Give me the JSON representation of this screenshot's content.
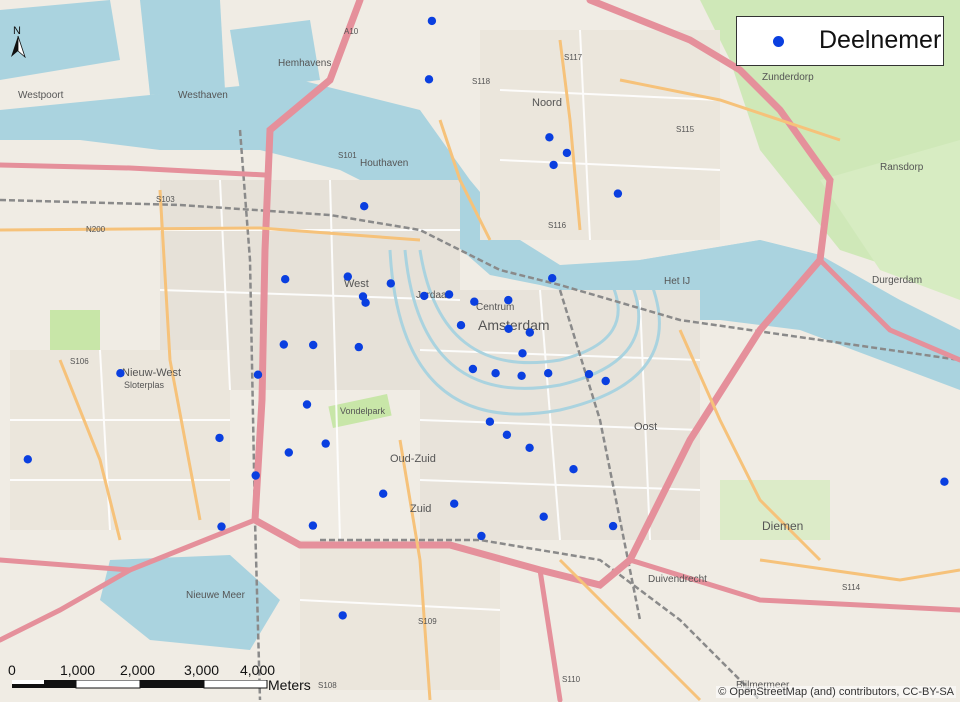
{
  "legend": {
    "label": "Deelnemer",
    "marker_color": "#0a3fe0"
  },
  "north_arrow": {
    "label": "N"
  },
  "scale_bar": {
    "ticks": [
      "0",
      "1,000",
      "2,000",
      "3,000",
      "4,000"
    ],
    "unit": "Meters"
  },
  "attribution": "© OpenStreetMap (and) contributors, CC-BY-SA",
  "place_labels": {
    "amsterdam": "Amsterdam",
    "centrum": "Centrum",
    "noord": "Noord",
    "west": "West",
    "nieuw_west": "Nieuw-West",
    "oost": "Oost",
    "zuid": "Zuid",
    "oud_zuid": "Oud-Zuid",
    "diemen": "Diemen",
    "durgerdam": "Durgerdam",
    "zunderdorp": "Zunderdorp",
    "ransdorp": "Ransdorp",
    "westpoort": "Westpoort",
    "hemhavens": "Hemhavens",
    "westhaven": "Westhaven",
    "houthaven": "Houthaven",
    "jordaan": "Jordaan",
    "ij": "Het IJ",
    "nieuwe_meer": "Nieuwe Meer",
    "duivendrecht": "Duivendrecht",
    "sloterplas": "Sloterplas",
    "vondelpark": "Vondelpark",
    "bijlmermeer": "Bijlmermeer"
  },
  "road_labels": {
    "a10": "A10",
    "s101": "S101",
    "s118": "S118",
    "s116": "S116",
    "s115": "S115",
    "s117": "S117",
    "s103": "S103",
    "s106": "S106",
    "s108": "S108",
    "s109": "S109",
    "s110": "S110",
    "s114": "S114",
    "n200": "N200"
  },
  "participants": [
    {
      "lon": 4.9035,
      "lat": 52.4045
    },
    {
      "lon": 4.9025,
      "lat": 52.3933
    },
    {
      "lon": 4.945,
      "lat": 52.3822
    },
    {
      "lon": 4.9465,
      "lat": 52.3769
    },
    {
      "lon": 4.9512,
      "lat": 52.3792
    },
    {
      "lon": 4.9692,
      "lat": 52.3714
    },
    {
      "lon": 4.8796,
      "lat": 52.369
    },
    {
      "lon": 4.8517,
      "lat": 52.355
    },
    {
      "lon": 4.8738,
      "lat": 52.3555
    },
    {
      "lon": 4.889,
      "lat": 52.3542
    },
    {
      "lon": 4.946,
      "lat": 52.3552
    },
    {
      "lon": 4.8792,
      "lat": 52.3517
    },
    {
      "lon": 4.8801,
      "lat": 52.3505
    },
    {
      "lon": 4.9008,
      "lat": 52.3518
    },
    {
      "lon": 4.9096,
      "lat": 52.3521
    },
    {
      "lon": 4.9185,
      "lat": 52.3507
    },
    {
      "lon": 4.9305,
      "lat": 52.351
    },
    {
      "lon": 4.9138,
      "lat": 52.3462
    },
    {
      "lon": 4.9306,
      "lat": 52.3455
    },
    {
      "lon": 4.9381,
      "lat": 52.3448
    },
    {
      "lon": 4.8512,
      "lat": 52.3425
    },
    {
      "lon": 4.8616,
      "lat": 52.3424
    },
    {
      "lon": 4.8777,
      "lat": 52.342
    },
    {
      "lon": 4.9355,
      "lat": 52.3408
    },
    {
      "lon": 4.7935,
      "lat": 52.337
    },
    {
      "lon": 4.8421,
      "lat": 52.3367
    },
    {
      "lon": 4.918,
      "lat": 52.3378
    },
    {
      "lon": 4.926,
      "lat": 52.337
    },
    {
      "lon": 4.9352,
      "lat": 52.3365
    },
    {
      "lon": 4.9446,
      "lat": 52.337
    },
    {
      "lon": 4.959,
      "lat": 52.3368
    },
    {
      "lon": 4.9649,
      "lat": 52.3355
    },
    {
      "lon": 4.8594,
      "lat": 52.331
    },
    {
      "lon": 4.924,
      "lat": 52.3277
    },
    {
      "lon": 4.8285,
      "lat": 52.3246
    },
    {
      "lon": 4.866,
      "lat": 52.3235
    },
    {
      "lon": 4.93,
      "lat": 52.3252
    },
    {
      "lon": 4.938,
      "lat": 52.3227
    },
    {
      "lon": 4.853,
      "lat": 52.3218
    },
    {
      "lon": 4.7608,
      "lat": 52.3205
    },
    {
      "lon": 4.9535,
      "lat": 52.3186
    },
    {
      "lon": 5.0845,
      "lat": 52.3162
    },
    {
      "lon": 4.8413,
      "lat": 52.3174
    },
    {
      "lon": 4.8863,
      "lat": 52.3139
    },
    {
      "lon": 4.9114,
      "lat": 52.312
    },
    {
      "lon": 4.943,
      "lat": 52.3095
    },
    {
      "lon": 4.8292,
      "lat": 52.3076
    },
    {
      "lon": 4.8615,
      "lat": 52.3078
    },
    {
      "lon": 4.921,
      "lat": 52.3058
    },
    {
      "lon": 4.9675,
      "lat": 52.3077
    },
    {
      "lon": 4.872,
      "lat": 52.2906
    }
  ]
}
